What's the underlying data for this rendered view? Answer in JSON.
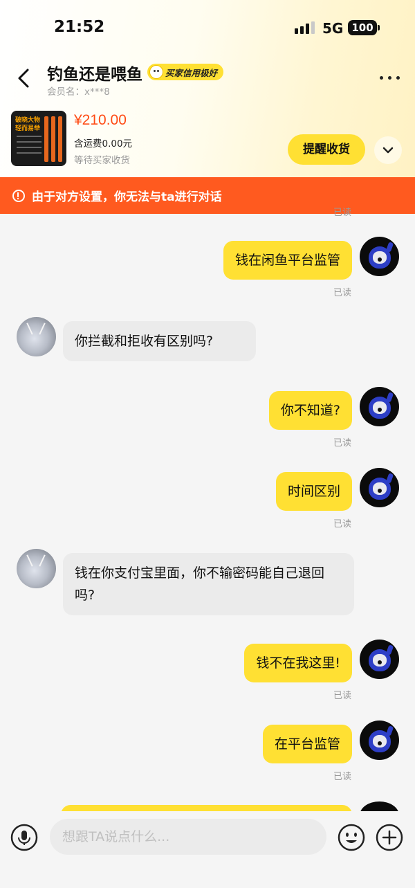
{
  "status_bar": {
    "time": "21:52",
    "network": "5G",
    "battery": "100"
  },
  "header": {
    "title": "钓鱼还是喂鱼",
    "credit_badge": "买家信用极好",
    "member_label": "会员名：x***8"
  },
  "product": {
    "image_text_1": "破晓大物",
    "image_text_2": "轻而易举",
    "price": "¥210.00",
    "shipping": "含运费0.00元",
    "status": "等待买家收货",
    "remind_button": "提醒收货"
  },
  "banner": {
    "text": "由于对方设置，你无法与ta进行对话"
  },
  "messages": [
    {
      "side": "out",
      "text": "钱在闲鱼平台监管",
      "read": "已读"
    },
    {
      "side": "in",
      "text": "你拦截和拒收有区别吗?"
    },
    {
      "side": "out",
      "text": "你不知道?",
      "read": "已读"
    },
    {
      "side": "out",
      "text": "时间区别",
      "read": "已读"
    },
    {
      "side": "in",
      "text": "钱在你支付宝里面，你不输密码能自己退回吗?"
    },
    {
      "side": "out",
      "text": "钱不在我这里!",
      "read": "已读"
    },
    {
      "side": "out",
      "text": "在平台监管",
      "read": "已读"
    }
  ],
  "top_partial_read": "已读",
  "input": {
    "placeholder": "想跟TA说点什么..."
  },
  "icons": {
    "back": "chevron-left-icon",
    "more": "more-dots-icon",
    "expand": "chevron-down-icon",
    "warning": "info-circle-icon",
    "mic": "mic-icon",
    "emoji": "smile-icon",
    "plus": "plus-icon"
  },
  "colors": {
    "accent": "#ffe033",
    "warning": "#ff5a1f",
    "price": "#ff4b14"
  }
}
